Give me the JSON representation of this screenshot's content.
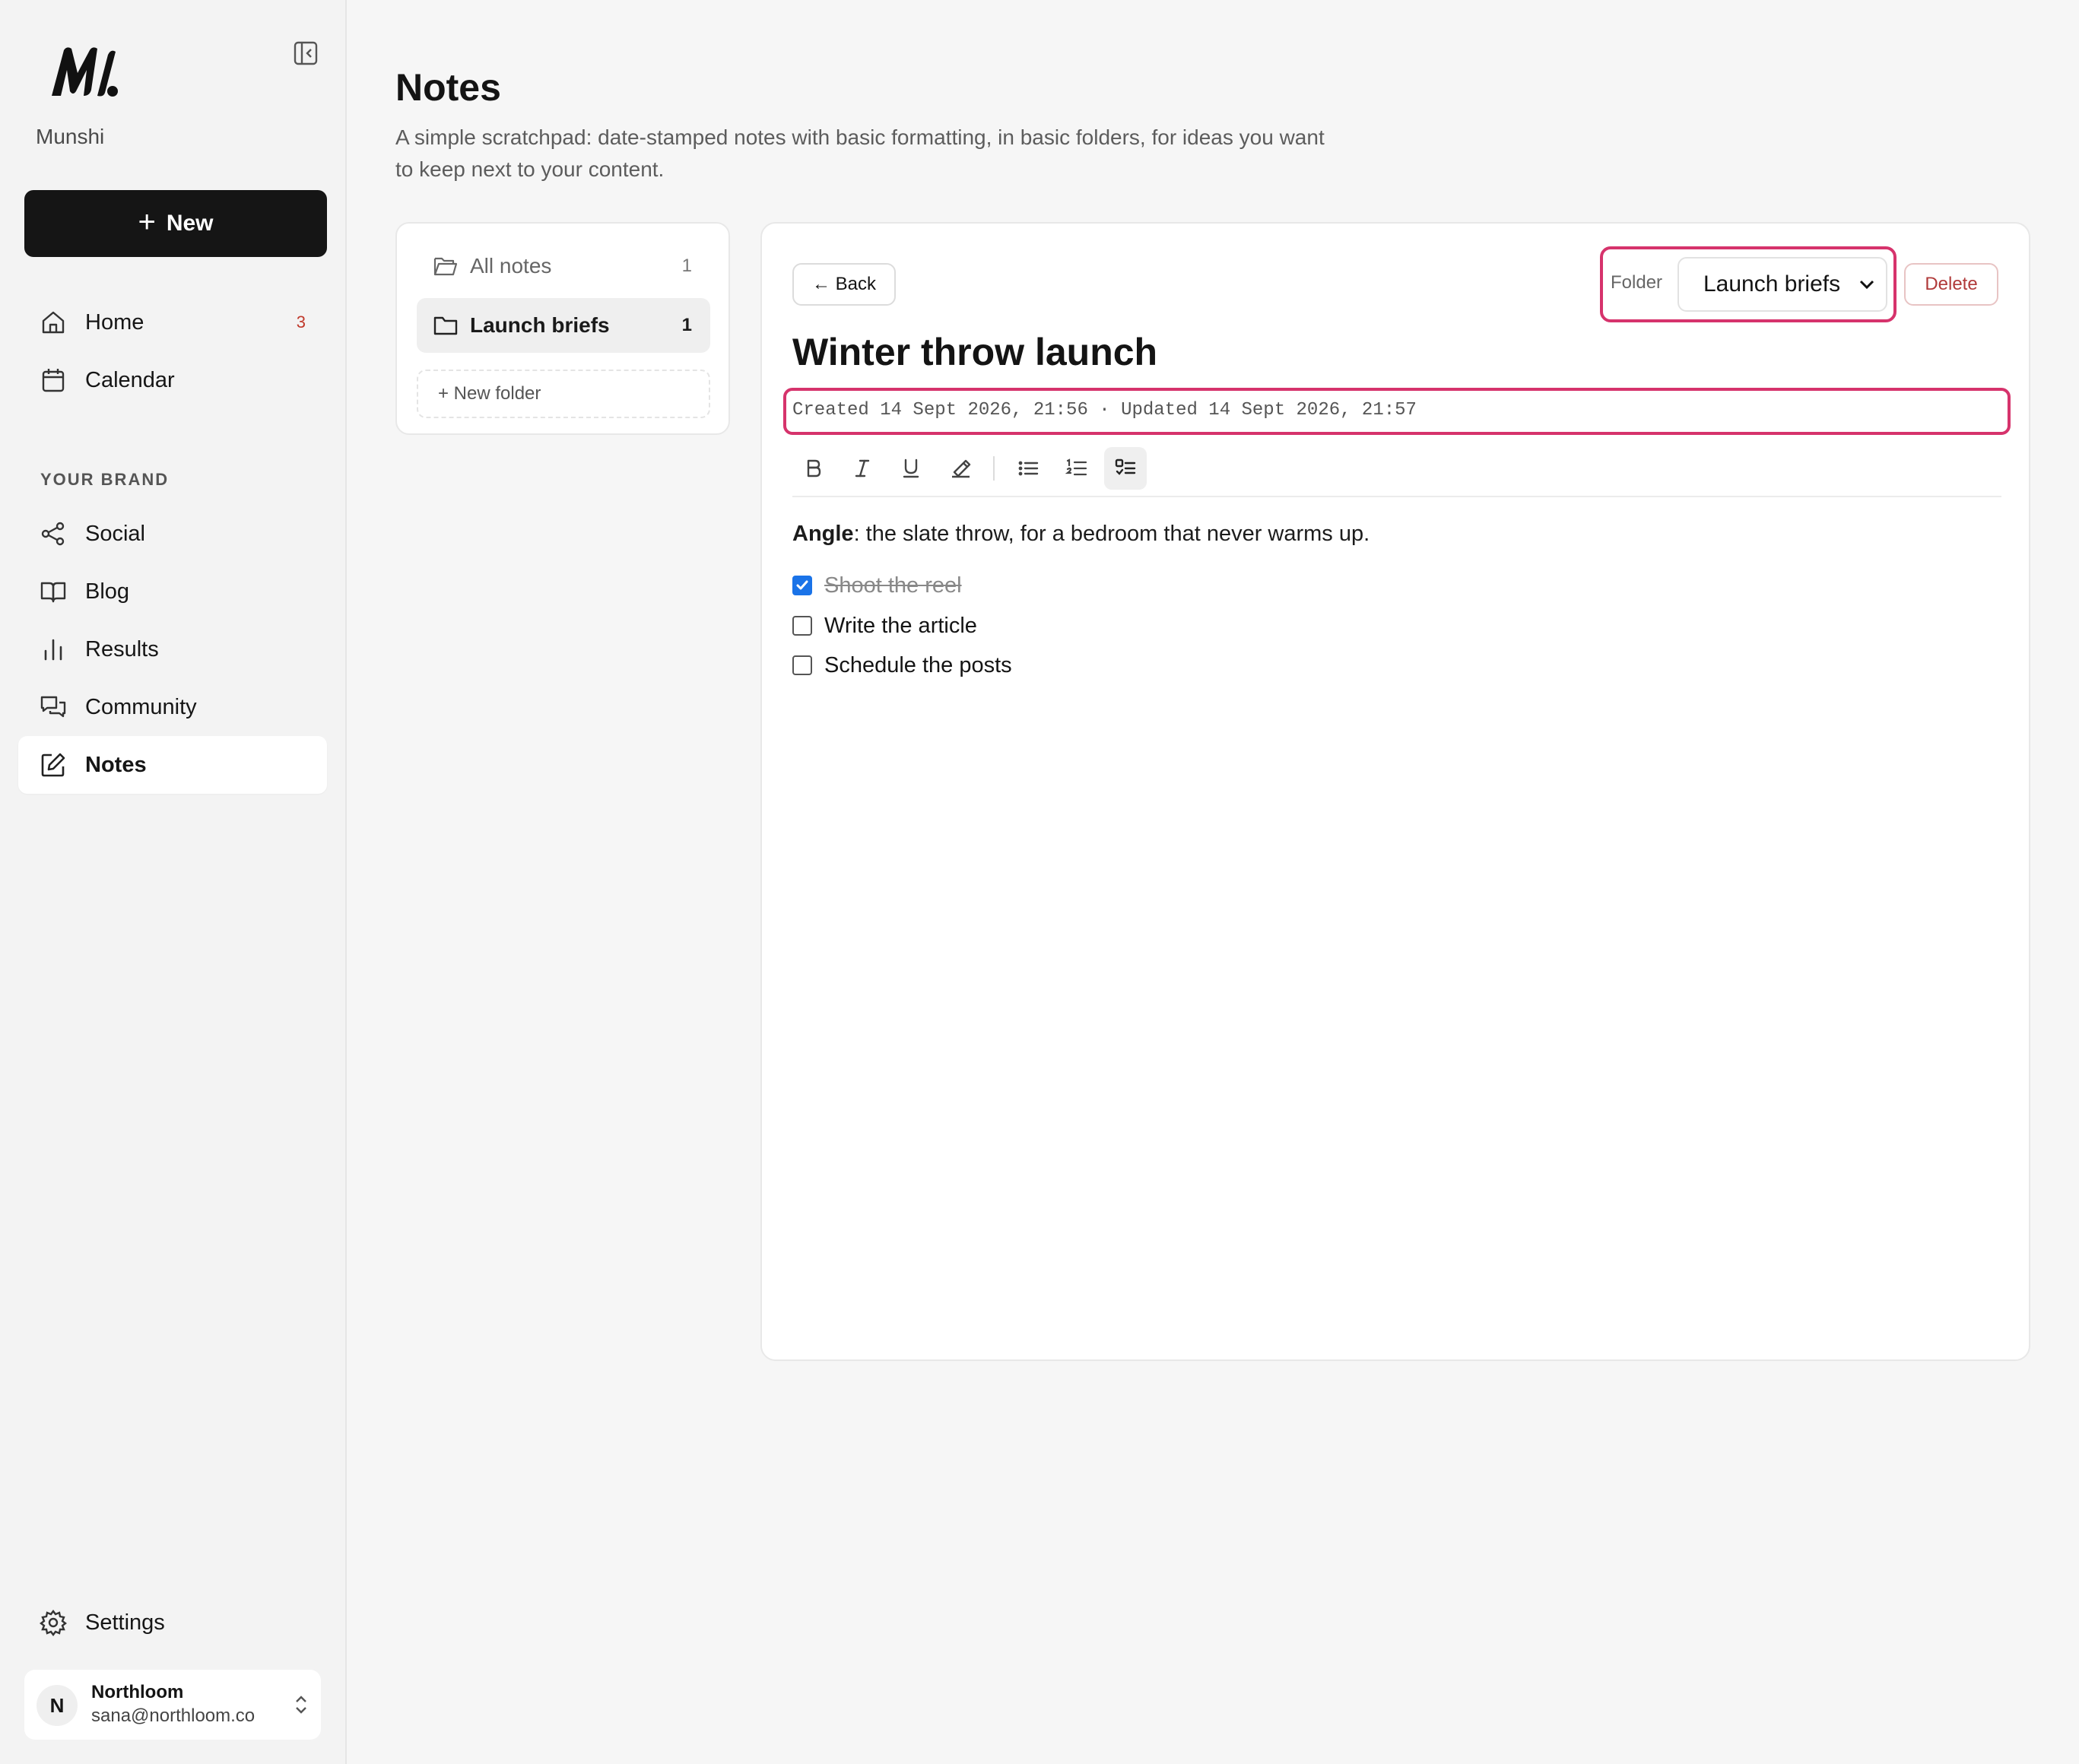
{
  "app": {
    "brand": "Munshi",
    "new_label": "New"
  },
  "sidebar": {
    "items": [
      {
        "label": "Home",
        "badge": "3"
      },
      {
        "label": "Calendar"
      },
      {
        "label": "Social"
      },
      {
        "label": "Blog"
      },
      {
        "label": "Results"
      },
      {
        "label": "Community"
      },
      {
        "label": "Notes",
        "active": true
      }
    ],
    "section_label": "YOUR BRAND",
    "settings_label": "Settings"
  },
  "account": {
    "initial": "N",
    "name": "Northloom",
    "email": "sana@northloom.co"
  },
  "header": {
    "title": "Notes",
    "description": "A simple scratchpad: date-stamped notes with basic formatting, in basic folders, for ideas you want to keep next to your content."
  },
  "folders": {
    "all": {
      "label": "All notes",
      "count": "1"
    },
    "items": [
      {
        "label": "Launch briefs",
        "count": "1",
        "selected": true
      }
    ],
    "new_folder_label": "+ New folder"
  },
  "editor": {
    "back_label": "← Back",
    "folder_label": "Folder",
    "folder_value": "Launch briefs",
    "delete_label": "Delete",
    "note_title": "Winter throw launch",
    "meta": "Created 14 Sept 2026, 21:56 · Updated 14 Sept 2026, 21:57",
    "body_bold": "Angle",
    "body_rest": ": the slate throw, for a bedroom that never warms up.",
    "checklist": [
      {
        "text": "Shoot the reel",
        "checked": true
      },
      {
        "text": "Write the article",
        "checked": false
      },
      {
        "text": "Schedule the posts",
        "checked": false
      }
    ],
    "toolbar": [
      "bold-icon",
      "italic-icon",
      "underline-icon",
      "highlight-icon",
      "bullet-list-icon",
      "numbered-list-icon",
      "checklist-icon"
    ]
  },
  "colors": {
    "accent_highlight": "#d6336c",
    "checkbox": "#1a73e8",
    "danger": "#b03a3a"
  }
}
